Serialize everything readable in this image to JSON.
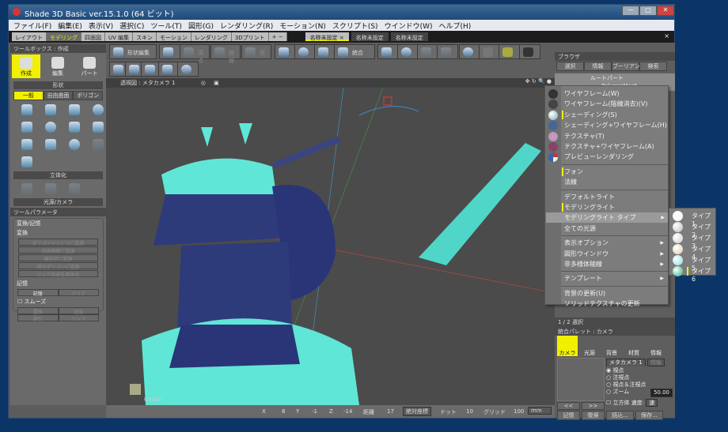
{
  "window": {
    "title": "Shade 3D Basic ver.15.1.0 (64 ビット)",
    "minimize": "—",
    "maximize": "□",
    "close": "✕"
  },
  "menubar": [
    "ファイル(F)",
    "編集(E)",
    "表示(V)",
    "選択(C)",
    "ツール(T)",
    "図形(G)",
    "レンダリング(R)",
    "モーション(N)",
    "スクリプト(S)",
    "ウインドウ(W)",
    "ヘルプ(H)"
  ],
  "mode_tabs": [
    {
      "label": "レイアウト"
    },
    {
      "label": "モデリング",
      "active": true
    },
    {
      "label": "四面図"
    },
    {
      "label": "UV 編集"
    },
    {
      "label": "スキン"
    },
    {
      "label": "モーション"
    },
    {
      "label": "レンダリング"
    },
    {
      "label": "3Dプリント"
    },
    {
      "label": "+ −"
    }
  ],
  "doc_tabs": [
    {
      "label": "名称未設定 ×",
      "active": true
    },
    {
      "label": "名称未設定"
    },
    {
      "label": "名称未設定"
    }
  ],
  "doc_tabs_close": "×",
  "toolbox": {
    "title": "ツールボックス : 作成",
    "modes": [
      {
        "label": "作成",
        "active": true
      },
      {
        "label": "編集"
      },
      {
        "label": "パート"
      }
    ],
    "sections": {
      "shape": "形状",
      "solidify": "立体化",
      "light_camera": "光源/カメラ"
    },
    "shape_tabs": [
      {
        "label": "一般",
        "active": true
      },
      {
        "label": "自由曲面"
      },
      {
        "label": "ポリゴン"
      }
    ]
  },
  "tool_params": {
    "title": "ツールパラメータ",
    "group": "変換/記憶",
    "convert_label": "変換",
    "convert_buttons": [
      "ポリゴンメッシュに変換",
      "自由曲面に変換",
      "線形状に変換",
      "掃引ポリゴンに変換",
      "リンク形状を実体化"
    ],
    "memory_label": "記憶",
    "memory_buttons": [
      "記憶",
      "クリア"
    ],
    "smooth": "スムーズ",
    "more_buttons": [
      "置換",
      "追加",
      "掃引",
      "リンク"
    ]
  },
  "toolbar": {
    "shape_edit": "形状編集",
    "vertex": "頂点",
    "edge": "稜線",
    "face": "面",
    "integrate": "統合"
  },
  "viewport": {
    "title": "透視図 : メタカメラ 1",
    "axis_label": "Global"
  },
  "status": {
    "x_label": "X",
    "x": "8",
    "y_label": "Y",
    "y": "-1",
    "z_label": "Z",
    "z": "-14",
    "dist_label": "距離",
    "dist": "17",
    "coord_mode": "絶対座標",
    "dot_label": "ドット",
    "dot": "10",
    "grid_label": "グリッド",
    "grid": "100",
    "unit": "mm"
  },
  "browser": {
    "title": "ブラウザ",
    "buttons": [
      "選択",
      "情報",
      "ブーリアン",
      "検索"
    ],
    "tree": [
      "ルートパート",
      "PolygonMesh"
    ],
    "footer": "1 / 2 選択"
  },
  "context_menu": {
    "items": [
      {
        "label": "ワイヤフレーム(W)",
        "icon": "wireframe-ball"
      },
      {
        "label": "ワイヤフレーム(陰線消去)(V)",
        "icon": "hidden-line-ball"
      },
      {
        "label": "シェーディング(S)",
        "icon": "shaded-ball",
        "checked": true
      },
      {
        "label": "シェーディング+ワイヤフレーム(H)",
        "icon": "shaded-wire-ball"
      },
      {
        "label": "テクスチャ(T)",
        "icon": "texture-ball"
      },
      {
        "label": "テクスチャ+ワイヤフレーム(A)",
        "icon": "texture-wire-ball"
      },
      {
        "label": "プレビューレンダリング",
        "icon": "preview-ball"
      },
      {
        "label": "フォン",
        "checked": true
      },
      {
        "label": "法線"
      },
      {
        "label": "デフォルトライト"
      },
      {
        "label": "モデリングライト",
        "checked": true
      },
      {
        "label": "モデリングライト タイプ",
        "submenu": true,
        "highlighted": true
      },
      {
        "label": "全ての光源"
      },
      {
        "label": "表示オプション",
        "submenu": true
      },
      {
        "label": "図形ウインドウ",
        "submenu": true
      },
      {
        "label": "非多様体稜線",
        "submenu": true
      },
      {
        "label": "テンプレート",
        "submenu": true
      },
      {
        "label": "背景の更新(U)"
      },
      {
        "label": "ソリッドテクスチャの更新"
      }
    ]
  },
  "light_type_submenu": [
    {
      "label": "タイプ 1"
    },
    {
      "label": "タイプ 2"
    },
    {
      "label": "タイプ 3"
    },
    {
      "label": "タイプ 4"
    },
    {
      "label": "タイプ 5"
    },
    {
      "label": "タイプ 6",
      "checked": true
    }
  ],
  "palette": {
    "title": "統合パレット : カメラ",
    "tabs": [
      {
        "label": "カメラ",
        "active": true
      },
      {
        "label": "光源"
      },
      {
        "label": "背景"
      },
      {
        "label": "材質"
      },
      {
        "label": "情報"
      }
    ],
    "camera_select": "メタカメラ 1",
    "info_btn": "情報",
    "radios": [
      {
        "label": "視点",
        "checked": true
      },
      {
        "label": "注視点"
      },
      {
        "label": "視点＆注視点"
      },
      {
        "label": "ズーム"
      }
    ],
    "zoom_value": "50.00",
    "cube": "立方体",
    "speed_label": "速度:",
    "speed": "速",
    "nav": [
      "<<",
      ">>"
    ],
    "buttons": [
      "記憶",
      "復帰",
      "読込...",
      "保存..."
    ]
  },
  "colors": {
    "accent": "#f0f000",
    "model": "#5fe6d6",
    "model_shadow": "#2a3577",
    "desktop": "#0b3566"
  }
}
